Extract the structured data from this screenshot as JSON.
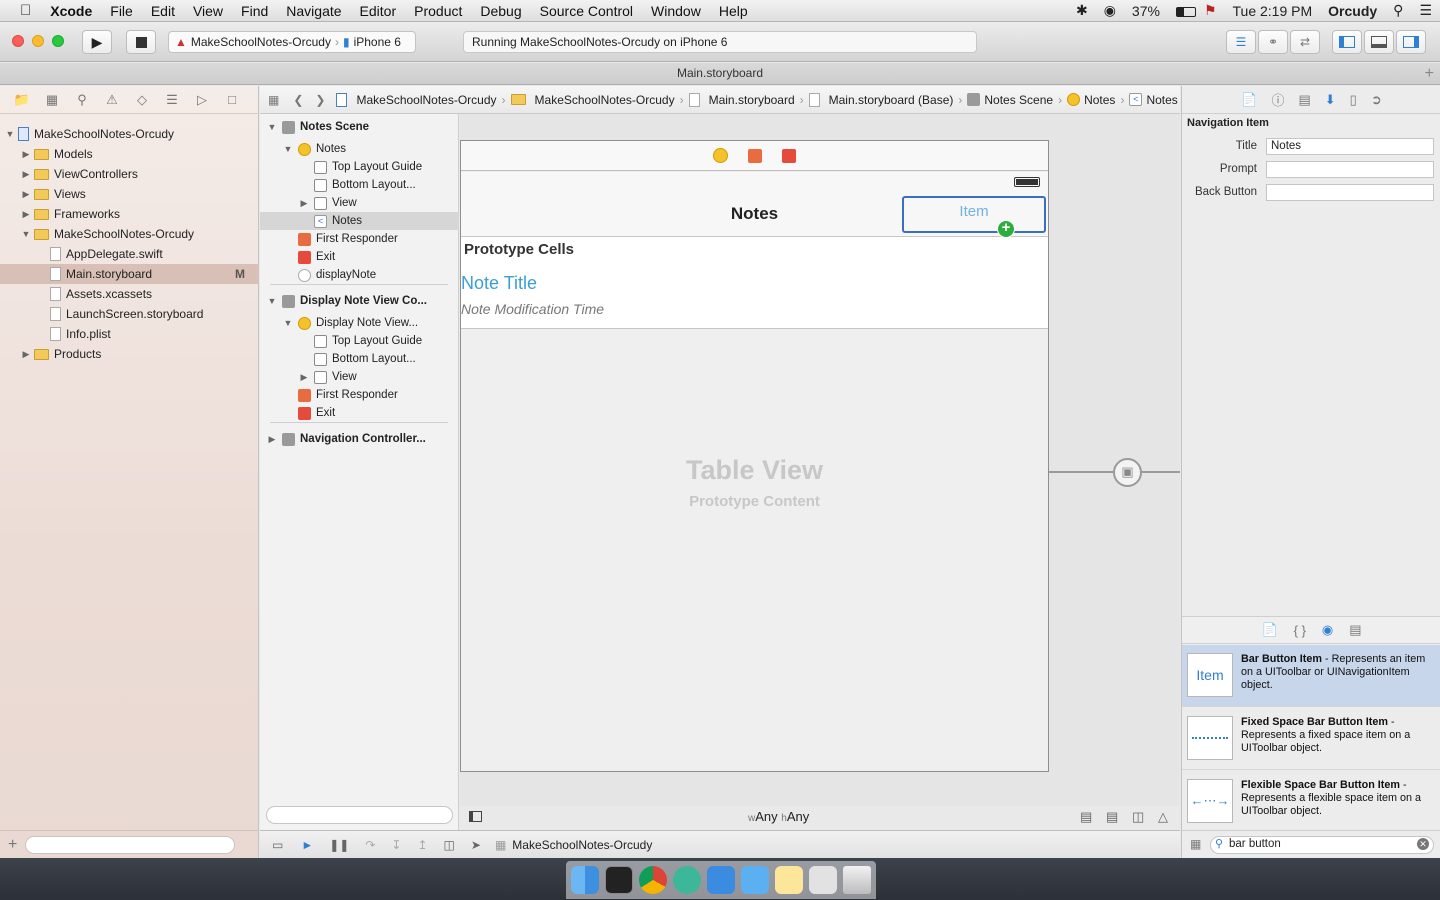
{
  "menubar": {
    "app": "Xcode",
    "items": [
      "File",
      "Edit",
      "View",
      "Find",
      "Navigate",
      "Editor",
      "Product",
      "Debug",
      "Source Control",
      "Window",
      "Help"
    ],
    "battery": "37%",
    "clock": "Tue 2:19 PM",
    "user": "Orcudy"
  },
  "toolbar": {
    "scheme": "MakeSchoolNotes-Orcudy",
    "device": "iPhone 6",
    "activity": "Running MakeSchoolNotes-Orcudy on iPhone 6"
  },
  "tab": {
    "title": "Main.storyboard"
  },
  "navigator": {
    "rows": [
      {
        "label": "MakeSchoolNotes-Orcudy",
        "level": 0,
        "kind": "project",
        "open": true
      },
      {
        "label": "Models",
        "level": 1,
        "kind": "folder",
        "open": false
      },
      {
        "label": "ViewControllers",
        "level": 1,
        "kind": "folder",
        "open": false
      },
      {
        "label": "Views",
        "level": 1,
        "kind": "folder",
        "open": false
      },
      {
        "label": "Frameworks",
        "level": 1,
        "kind": "folder",
        "open": false
      },
      {
        "label": "MakeSchoolNotes-Orcudy",
        "level": 1,
        "kind": "folder",
        "open": true
      },
      {
        "label": "AppDelegate.swift",
        "level": 2,
        "kind": "file"
      },
      {
        "label": "Main.storyboard",
        "level": 2,
        "kind": "file",
        "badge": "M",
        "selected": true
      },
      {
        "label": "Assets.xcassets",
        "level": 2,
        "kind": "file"
      },
      {
        "label": "LaunchScreen.storyboard",
        "level": 2,
        "kind": "file"
      },
      {
        "label": "Info.plist",
        "level": 2,
        "kind": "file"
      },
      {
        "label": "Products",
        "level": 1,
        "kind": "folder",
        "open": false
      }
    ]
  },
  "jumpbar": {
    "crumbs": [
      "MakeSchoolNotes-Orcudy",
      "MakeSchoolNotes-Orcudy",
      "Main.storyboard",
      "Main.storyboard (Base)",
      "Notes Scene",
      "Notes",
      "Notes"
    ]
  },
  "outline": {
    "rows": [
      {
        "label": "Notes Scene",
        "level": 0,
        "icon": "scene",
        "open": true,
        "bold": true
      },
      {
        "label": "Notes",
        "level": 1,
        "icon": "vc",
        "open": true
      },
      {
        "label": "Top Layout Guide",
        "level": 2,
        "icon": "view"
      },
      {
        "label": "Bottom Layout...",
        "level": 2,
        "icon": "view"
      },
      {
        "label": "View",
        "level": 2,
        "icon": "view",
        "open": false
      },
      {
        "label": "Notes",
        "level": 2,
        "icon": "nav",
        "selected": true
      },
      {
        "label": "First Responder",
        "level": 1,
        "icon": "resp"
      },
      {
        "label": "Exit",
        "level": 1,
        "icon": "exit"
      },
      {
        "label": "displayNote",
        "level": 1,
        "icon": "seg"
      },
      {
        "label": "Display Note View Co...",
        "level": 0,
        "icon": "scene",
        "open": true,
        "bold": true
      },
      {
        "label": "Display Note View...",
        "level": 1,
        "icon": "vc",
        "open": true
      },
      {
        "label": "Top Layout Guide",
        "level": 2,
        "icon": "view"
      },
      {
        "label": "Bottom Layout...",
        "level": 2,
        "icon": "view"
      },
      {
        "label": "View",
        "level": 2,
        "icon": "view",
        "open": false
      },
      {
        "label": "First Responder",
        "level": 1,
        "icon": "resp"
      },
      {
        "label": "Exit",
        "level": 1,
        "icon": "exit"
      },
      {
        "label": "Navigation Controller...",
        "level": 0,
        "icon": "scene",
        "open": false,
        "bold": true
      }
    ]
  },
  "canvas": {
    "nav_title": "Notes",
    "bar_item": "Item",
    "proto_header": "Prototype Cells",
    "cell_title": "Note Title",
    "cell_subtitle": "Note Modification Time",
    "table_title": "Table View",
    "table_subtitle": "Prototype Content",
    "size_w_prefix": "w",
    "size_w": "Any",
    "size_h_prefix": "h",
    "size_h": "Any"
  },
  "inspector": {
    "section": "Navigation Item",
    "title_label": "Title",
    "title_value": "Notes",
    "prompt_label": "Prompt",
    "prompt_value": "",
    "back_label": "Back Button",
    "back_value": ""
  },
  "library": {
    "items": [
      {
        "name": "Bar Button Item",
        "desc": " - Represents an item on a UIToolbar or UINavigationItem object.",
        "thumb": "Item",
        "selected": true
      },
      {
        "name": "Fixed Space Bar Button Item",
        "desc": " - Represents a fixed space item on a UIToolbar object.",
        "thumb": "fixed"
      },
      {
        "name": "Flexible Space Bar Button Item",
        "desc": " - Represents a flexible space item on a UIToolbar object.",
        "thumb": "flex"
      }
    ],
    "search": "bar button"
  },
  "debugbar": {
    "target": "MakeSchoolNotes-Orcudy"
  },
  "colors": {
    "accent": "#2f7fd3",
    "selection": "#d8c0b6",
    "link": "#39a0d6"
  }
}
